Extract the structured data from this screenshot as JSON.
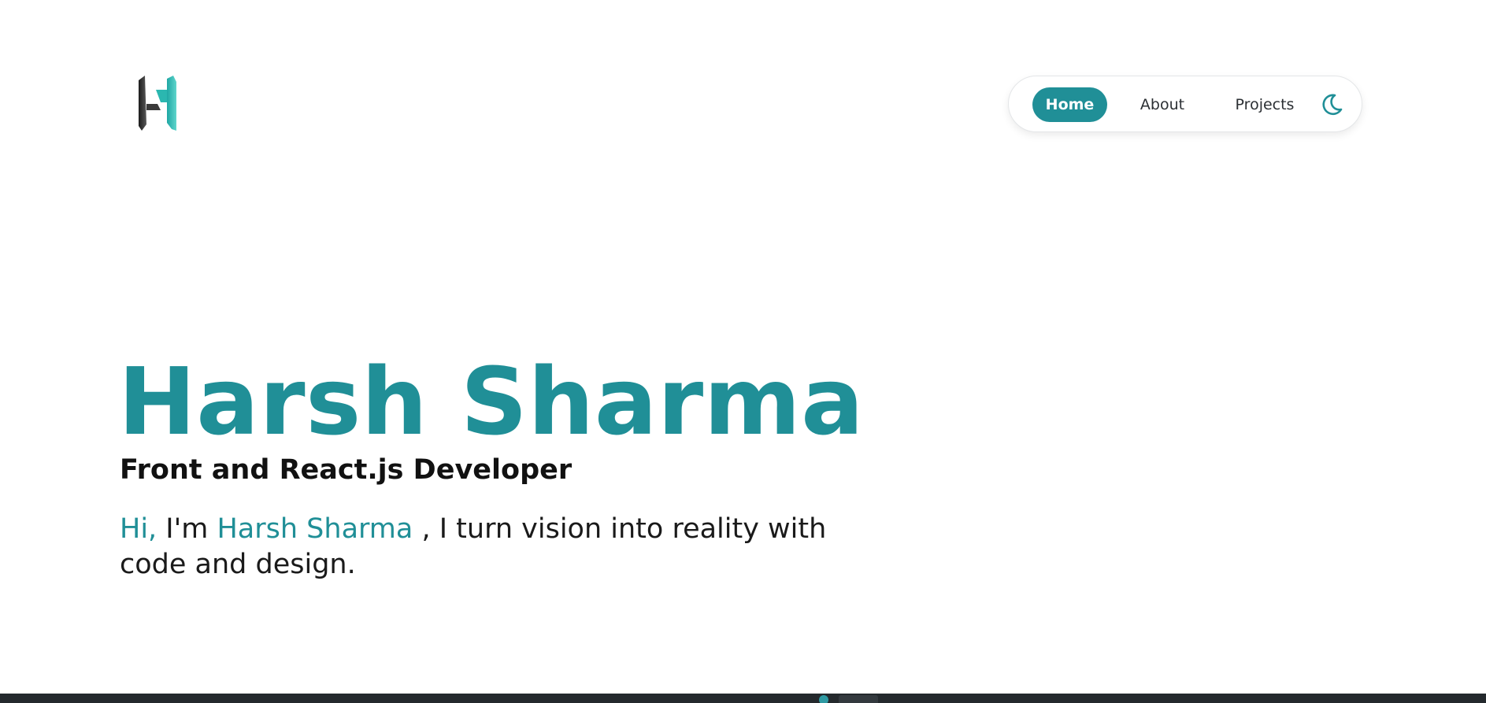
{
  "brand": {
    "logo_icon": "h-monogram-logo-icon",
    "accent_color": "#208f97",
    "dark_color": "#2b2b2b"
  },
  "nav": {
    "items": [
      {
        "label": "Home",
        "active": true
      },
      {
        "label": "About",
        "active": false
      },
      {
        "label": "Projects",
        "active": false
      }
    ],
    "theme_toggle_icon": "moon-icon"
  },
  "hero": {
    "name": "Harsh Sharma",
    "role": "Front and React.js Developer",
    "intro": {
      "greeting": "Hi,",
      "im": " I'm ",
      "name": "Harsh Sharma",
      "rest": " , I turn vision into reality with code and design."
    }
  }
}
